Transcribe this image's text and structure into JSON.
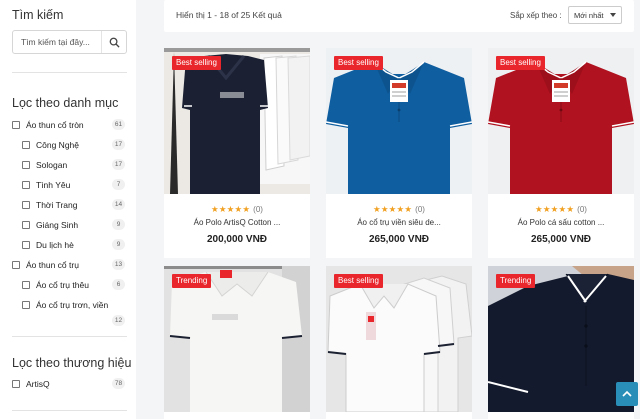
{
  "sidebar": {
    "search_title": "Tìm kiếm",
    "search_placeholder": "Tìm kiếm tại đây...",
    "category_title": "Lọc theo danh mục",
    "categories": [
      {
        "label": "Áo thun cổ tròn",
        "count": "61"
      },
      {
        "label": "Công Nghệ",
        "count": "17"
      },
      {
        "label": "Sologan",
        "count": "17"
      },
      {
        "label": "Tình Yêu",
        "count": "7"
      },
      {
        "label": "Thời Trang",
        "count": "14"
      },
      {
        "label": "Giáng Sinh",
        "count": "9"
      },
      {
        "label": "Du lịch hè",
        "count": "9"
      },
      {
        "label": "Áo thun cổ trụ",
        "count": "13"
      },
      {
        "label": "Áo cổ trụ thêu",
        "count": "6"
      },
      {
        "label": "Áo cổ trụ trơn, viền",
        "count": "12"
      }
    ],
    "brand_title": "Lọc theo thương hiệu",
    "brands": [
      {
        "label": "ArtisQ",
        "count": "78"
      }
    ]
  },
  "topbar": {
    "results_text": "Hiển thị 1 - 18 of 25 Kết quả",
    "sort_label": "Sắp xếp theo :",
    "sort_value": "Mới nhất"
  },
  "products": [
    {
      "badge": "Best selling",
      "reviews": "(0)",
      "name": "Áo Polo ArtisQ Cotton ...",
      "price": "200,000 VNĐ",
      "stars": "★★★★★"
    },
    {
      "badge": "Best selling",
      "reviews": "(0)",
      "name": "Áo cổ trụ viền siêu de...",
      "price": "265,000 VNĐ",
      "stars": "★★★★★"
    },
    {
      "badge": "Best selling",
      "reviews": "(0)",
      "name": "Áo Polo cá sấu cotton ...",
      "price": "265,000 VNĐ",
      "stars": "★★★★★"
    },
    {
      "badge": "Trending"
    },
    {
      "badge": "Best selling"
    },
    {
      "badge": "Trending"
    }
  ],
  "colors": {
    "badge": "#e8262b",
    "star": "#f1a020",
    "scroll_button": "#2a8fb8"
  }
}
